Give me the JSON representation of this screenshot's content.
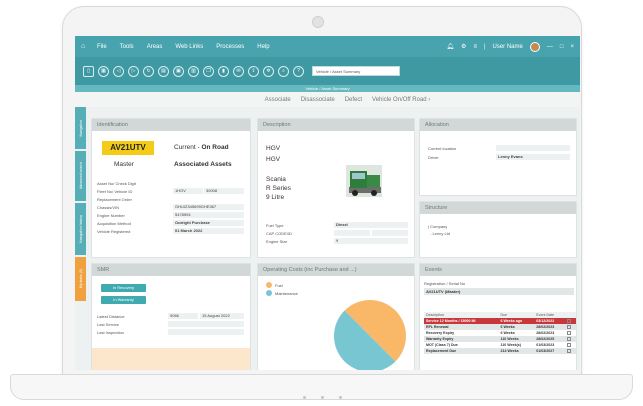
{
  "menubar": {
    "items": [
      "File",
      "Tools",
      "Areas",
      "Web Links",
      "Processes",
      "Help"
    ],
    "user_name": "User Name",
    "window_controls": [
      "—",
      "□",
      "×"
    ]
  },
  "toolbar": {
    "search_placeholder": "Vehicle / Asset Summary"
  },
  "subbar": {
    "title": "Vehicle / Asset Summary"
  },
  "actions": [
    "Associate",
    "Disassociate",
    "Defect",
    "Vehicle On/Off Road"
  ],
  "sidetabs": [
    "Navigation",
    "Advanced search",
    "Navigation history",
    "My tasks (0)"
  ],
  "identification": {
    "title": "Identification",
    "reg": "AV21UTV",
    "status_prefix": "Current -",
    "status": "On Road",
    "master": "Master",
    "associated": "Associated Assets",
    "fields": [
      {
        "label": "Asset No/ Check Digit",
        "value": ""
      },
      {
        "label": "Fleet No/ Vehicle ID",
        "value": "1HGV",
        "value2": "30008"
      },
      {
        "label": "Replacement Order",
        "value": ""
      },
      {
        "label": "Chassis/VIN",
        "value": "GHUIZ345699GHE367"
      },
      {
        "label": "Engine Number",
        "value": "5478594"
      },
      {
        "label": "Acquisition Method",
        "value": "Outright Purchase"
      },
      {
        "label": "Vehicle Registered",
        "value": "01 March 2022"
      }
    ]
  },
  "description": {
    "title": "Description",
    "lines": [
      "HGV",
      "HGV",
      "Scania",
      "R Series",
      "9 Litre"
    ],
    "fields": [
      {
        "label": "Fuel Type",
        "value": "Diesel"
      },
      {
        "label": "CAP CODE/ID",
        "value": ""
      },
      {
        "label": "Engine Size",
        "value": "9"
      }
    ]
  },
  "allocation": {
    "title": "Allocation",
    "fields": [
      {
        "label": "Current location",
        "value": ""
      },
      {
        "label": "Driver",
        "value": "Lenny Evans"
      }
    ]
  },
  "structure": {
    "title": "Structure",
    "lines": [
      "| Company",
      "- Lenny Ltd"
    ]
  },
  "smr": {
    "title": "SMR",
    "buttons": [
      "In Recovery",
      "In Warranty"
    ],
    "fields": [
      {
        "label": "Latest Distance",
        "value": "9066",
        "value2": "15 August 2022"
      },
      {
        "label": "Last Service",
        "value": ""
      },
      {
        "label": "Last Inspection",
        "value": ""
      }
    ]
  },
  "costs": {
    "title": "Operating Costs (inc Purchase and ...)"
  },
  "chart_data": {
    "type": "pie",
    "categories": [
      "Fuel",
      "Maintenance"
    ],
    "values": [
      50,
      50
    ],
    "colors": [
      "#f9b868",
      "#79c6d3"
    ]
  },
  "events": {
    "title": "Events",
    "reg_label": "Registration / Serial No",
    "reg_value": "AV21UTV (Master)",
    "columns": [
      "Description",
      "Due",
      "Event Date"
    ],
    "rows": [
      {
        "desc": "Service 12 Months / 15000 Mi",
        "due": "6 Weeks ago",
        "date": "03/12/2022",
        "style": "red"
      },
      {
        "desc": "RFL Renewal",
        "due": "6 Weeks",
        "date": "28/02/2023",
        "style": "alt"
      },
      {
        "desc": "Recovery Expiry",
        "due": "6 Weeks",
        "date": "28/02/2023",
        "style": "plain"
      },
      {
        "desc": "Warranty Expiry",
        "due": "110 Weeks",
        "date": "28/02/2025",
        "style": "alt"
      },
      {
        "desc": "MOT (Class 7) Due",
        "due": "110 Week(s)",
        "date": "01/03/2023",
        "style": "plain"
      },
      {
        "desc": "Replacement Due",
        "due": "214 Weeks",
        "date": "01/03/2027",
        "style": "alt"
      }
    ]
  }
}
